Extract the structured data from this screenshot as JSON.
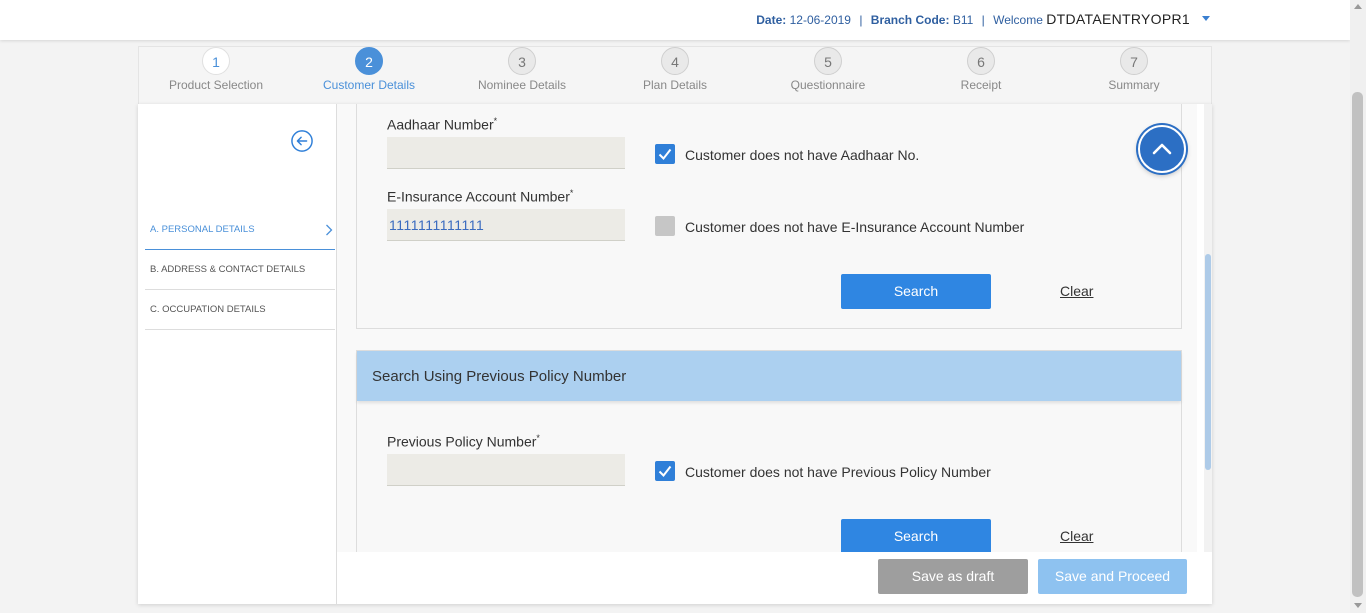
{
  "header": {
    "date_label": "Date:",
    "date_value": "12-06-2019",
    "branch_label": "Branch Code:",
    "branch_value": "B11",
    "welcome_label": "Welcome",
    "user_name": "DTDATAENTRYOPR1",
    "separator": "|"
  },
  "steps": [
    {
      "number": "1",
      "label": "Product Selection",
      "state": "done"
    },
    {
      "number": "2",
      "label": "Customer Details",
      "state": "active"
    },
    {
      "number": "3",
      "label": "Nominee Details",
      "state": "pending"
    },
    {
      "number": "4",
      "label": "Plan Details",
      "state": "pending"
    },
    {
      "number": "5",
      "label": "Questionnaire",
      "state": "pending"
    },
    {
      "number": "6",
      "label": "Receipt",
      "state": "pending"
    },
    {
      "number": "7",
      "label": "Summary",
      "state": "pending"
    }
  ],
  "sidebar": {
    "back_icon": "back-arrow-circle-icon",
    "items": [
      {
        "label": "A. PERSONAL DETAILS",
        "active": true
      },
      {
        "label": "B. ADDRESS & CONTACT DETAILS",
        "active": false
      },
      {
        "label": "C. OCCUPATION DETAILS",
        "active": false
      }
    ]
  },
  "identity_search": {
    "aadhaar_label": "Aadhaar Number",
    "aadhaar_value": "",
    "aadhaar_checkbox_label": "Customer does not have Aadhaar No.",
    "aadhaar_checked": true,
    "einsurance_label": "E-Insurance Account Number",
    "einsurance_value": "1111111111111",
    "einsurance_checkbox_label": "Customer does not have E-Insurance Account Number",
    "einsurance_checked": false,
    "required_mark": "*",
    "search_label": "Search",
    "clear_label": "Clear"
  },
  "policy_search": {
    "title": "Search Using Previous Policy Number",
    "policy_label": "Previous Policy Number",
    "policy_value": "",
    "policy_checkbox_label": "Customer does not have Previous Policy Number",
    "policy_checked": true,
    "search_label": "Search",
    "clear_label": "Clear"
  },
  "footer": {
    "draft_label": "Save as draft",
    "proceed_label": "Save and Proceed"
  },
  "colors": {
    "accent": "#2f86e2",
    "step_active": "#4a90d9",
    "section_header": "#acd0f0",
    "draft_button": "#9e9e9e",
    "proceed_button": "#8ec2f0"
  }
}
